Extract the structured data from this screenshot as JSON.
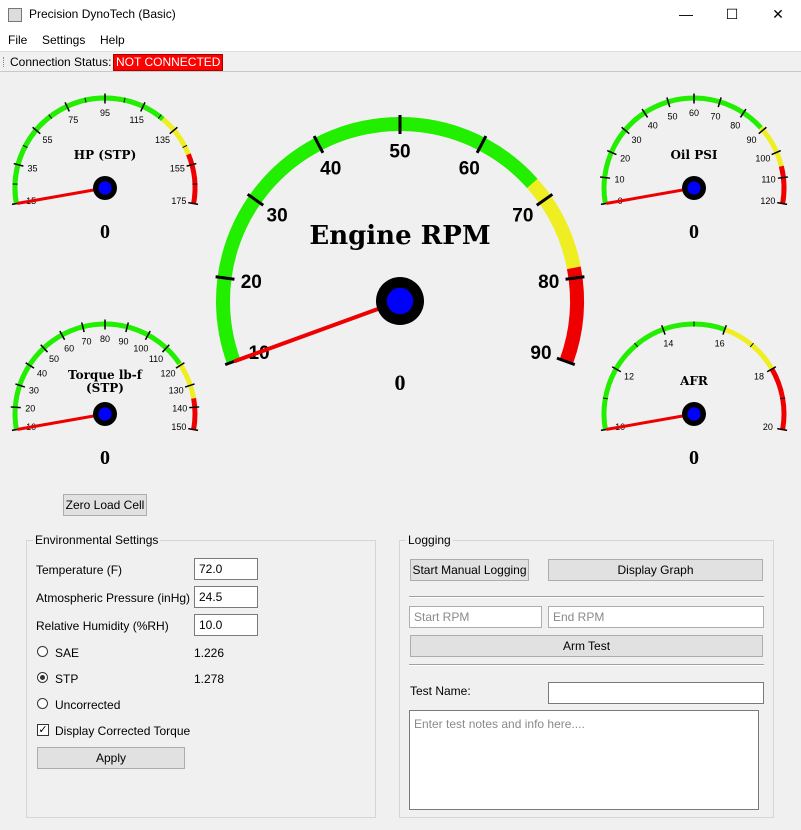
{
  "window": {
    "title": "Precision DynoTech (Basic)",
    "minimize_icon": "minimize-icon",
    "maximize_icon": "maximize-icon",
    "close_icon": "close-icon",
    "minimize_glyph": "—",
    "maximize_glyph": "☐",
    "close_glyph": "✕"
  },
  "menu": {
    "items": [
      "File",
      "Settings",
      "Help"
    ]
  },
  "status": {
    "label": "Connection Status:",
    "value": "NOT CONNECTED",
    "color": "#ff0000"
  },
  "colors": {
    "green": "#22ee00",
    "yellow": "#eeee22",
    "red": "#ee0000",
    "needle": "#ee0000",
    "hub": "#0000ff"
  },
  "gauges": {
    "hp": {
      "title": "HP (STP)",
      "readout": "0",
      "ticks": [
        "15",
        "35",
        "55",
        "75",
        "95",
        "115",
        "135",
        "155",
        "175"
      ],
      "value": 0
    },
    "rpm": {
      "title": "Engine RPM",
      "readout": "0",
      "ticks": [
        "10",
        "20",
        "30",
        "40",
        "50",
        "60",
        "70",
        "80",
        "90"
      ],
      "value": 0
    },
    "oil": {
      "title": "Oil PSI",
      "readout": "0",
      "ticks": [
        "0",
        "10",
        "20",
        "30",
        "40",
        "50",
        "60",
        "70",
        "80",
        "90",
        "100",
        "110",
        "120"
      ],
      "value": 0
    },
    "torque": {
      "title_line1": "Torque lb-f",
      "title_line2": "(STP)",
      "readout": "0",
      "ticks": [
        "10",
        "20",
        "30",
        "40",
        "50",
        "60",
        "70",
        "80",
        "90",
        "100",
        "110",
        "120",
        "130",
        "140",
        "150"
      ],
      "value": 0
    },
    "afr": {
      "title": "AFR",
      "readout": "0",
      "ticks": [
        "10",
        "12",
        "14",
        "16",
        "18",
        "20"
      ],
      "value": 0
    }
  },
  "zero_load_cell": "Zero Load Cell",
  "environment": {
    "title": "Environmental Settings",
    "temperature": {
      "label": "Temperature (F)",
      "value": "72.0"
    },
    "pressure": {
      "label": "Atmospheric Pressure (inHg)",
      "value": "24.5"
    },
    "humidity": {
      "label": "Relative Humidity (%RH)",
      "value": "10.0"
    },
    "sae": {
      "label": "SAE",
      "factor": "1.226",
      "selected": false
    },
    "stp": {
      "label": "STP",
      "factor": "1.278",
      "selected": true
    },
    "uncorrected": {
      "label": "Uncorrected",
      "selected": false
    },
    "display_corrected": {
      "label": "Display Corrected Torque",
      "checked": true
    },
    "apply": "Apply"
  },
  "logging": {
    "title": "Logging",
    "start_manual": "Start Manual Logging",
    "display_graph": "Display Graph",
    "start_rpm_placeholder": "Start RPM",
    "end_rpm_placeholder": "End RPM",
    "arm_test": "Arm Test",
    "test_name_label": "Test Name:",
    "test_name_value": "",
    "notes_placeholder": "Enter test notes and info here...."
  }
}
